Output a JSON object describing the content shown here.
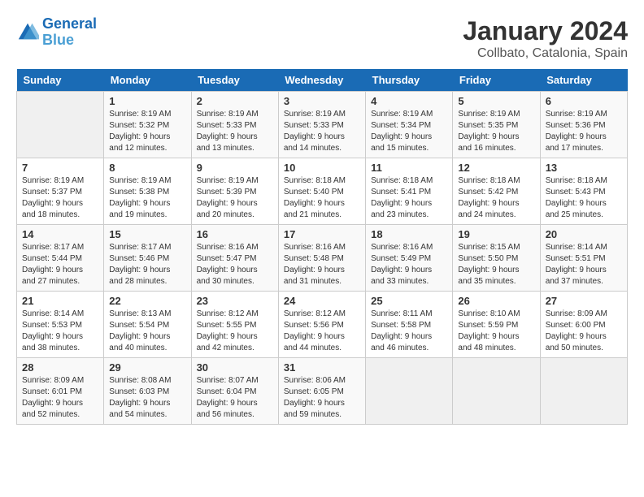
{
  "header": {
    "logo_line1": "General",
    "logo_line2": "Blue",
    "title": "January 2024",
    "subtitle": "Collbato, Catalonia, Spain"
  },
  "days_of_week": [
    "Sunday",
    "Monday",
    "Tuesday",
    "Wednesday",
    "Thursday",
    "Friday",
    "Saturday"
  ],
  "weeks": [
    [
      {
        "day": "",
        "empty": true
      },
      {
        "day": "1",
        "sunrise": "8:19 AM",
        "sunset": "5:32 PM",
        "daylight": "9 hours and 12 minutes."
      },
      {
        "day": "2",
        "sunrise": "8:19 AM",
        "sunset": "5:33 PM",
        "daylight": "9 hours and 13 minutes."
      },
      {
        "day": "3",
        "sunrise": "8:19 AM",
        "sunset": "5:33 PM",
        "daylight": "9 hours and 14 minutes."
      },
      {
        "day": "4",
        "sunrise": "8:19 AM",
        "sunset": "5:34 PM",
        "daylight": "9 hours and 15 minutes."
      },
      {
        "day": "5",
        "sunrise": "8:19 AM",
        "sunset": "5:35 PM",
        "daylight": "9 hours and 16 minutes."
      },
      {
        "day": "6",
        "sunrise": "8:19 AM",
        "sunset": "5:36 PM",
        "daylight": "9 hours and 17 minutes."
      }
    ],
    [
      {
        "day": "7",
        "sunrise": "8:19 AM",
        "sunset": "5:37 PM",
        "daylight": "9 hours and 18 minutes."
      },
      {
        "day": "8",
        "sunrise": "8:19 AM",
        "sunset": "5:38 PM",
        "daylight": "9 hours and 19 minutes."
      },
      {
        "day": "9",
        "sunrise": "8:19 AM",
        "sunset": "5:39 PM",
        "daylight": "9 hours and 20 minutes."
      },
      {
        "day": "10",
        "sunrise": "8:18 AM",
        "sunset": "5:40 PM",
        "daylight": "9 hours and 21 minutes."
      },
      {
        "day": "11",
        "sunrise": "8:18 AM",
        "sunset": "5:41 PM",
        "daylight": "9 hours and 23 minutes."
      },
      {
        "day": "12",
        "sunrise": "8:18 AM",
        "sunset": "5:42 PM",
        "daylight": "9 hours and 24 minutes."
      },
      {
        "day": "13",
        "sunrise": "8:18 AM",
        "sunset": "5:43 PM",
        "daylight": "9 hours and 25 minutes."
      }
    ],
    [
      {
        "day": "14",
        "sunrise": "8:17 AM",
        "sunset": "5:44 PM",
        "daylight": "9 hours and 27 minutes."
      },
      {
        "day": "15",
        "sunrise": "8:17 AM",
        "sunset": "5:46 PM",
        "daylight": "9 hours and 28 minutes."
      },
      {
        "day": "16",
        "sunrise": "8:16 AM",
        "sunset": "5:47 PM",
        "daylight": "9 hours and 30 minutes."
      },
      {
        "day": "17",
        "sunrise": "8:16 AM",
        "sunset": "5:48 PM",
        "daylight": "9 hours and 31 minutes."
      },
      {
        "day": "18",
        "sunrise": "8:16 AM",
        "sunset": "5:49 PM",
        "daylight": "9 hours and 33 minutes."
      },
      {
        "day": "19",
        "sunrise": "8:15 AM",
        "sunset": "5:50 PM",
        "daylight": "9 hours and 35 minutes."
      },
      {
        "day": "20",
        "sunrise": "8:14 AM",
        "sunset": "5:51 PM",
        "daylight": "9 hours and 37 minutes."
      }
    ],
    [
      {
        "day": "21",
        "sunrise": "8:14 AM",
        "sunset": "5:53 PM",
        "daylight": "9 hours and 38 minutes."
      },
      {
        "day": "22",
        "sunrise": "8:13 AM",
        "sunset": "5:54 PM",
        "daylight": "9 hours and 40 minutes."
      },
      {
        "day": "23",
        "sunrise": "8:12 AM",
        "sunset": "5:55 PM",
        "daylight": "9 hours and 42 minutes."
      },
      {
        "day": "24",
        "sunrise": "8:12 AM",
        "sunset": "5:56 PM",
        "daylight": "9 hours and 44 minutes."
      },
      {
        "day": "25",
        "sunrise": "8:11 AM",
        "sunset": "5:58 PM",
        "daylight": "9 hours and 46 minutes."
      },
      {
        "day": "26",
        "sunrise": "8:10 AM",
        "sunset": "5:59 PM",
        "daylight": "9 hours and 48 minutes."
      },
      {
        "day": "27",
        "sunrise": "8:09 AM",
        "sunset": "6:00 PM",
        "daylight": "9 hours and 50 minutes."
      }
    ],
    [
      {
        "day": "28",
        "sunrise": "8:09 AM",
        "sunset": "6:01 PM",
        "daylight": "9 hours and 52 minutes."
      },
      {
        "day": "29",
        "sunrise": "8:08 AM",
        "sunset": "6:03 PM",
        "daylight": "9 hours and 54 minutes."
      },
      {
        "day": "30",
        "sunrise": "8:07 AM",
        "sunset": "6:04 PM",
        "daylight": "9 hours and 56 minutes."
      },
      {
        "day": "31",
        "sunrise": "8:06 AM",
        "sunset": "6:05 PM",
        "daylight": "9 hours and 59 minutes."
      },
      {
        "day": "",
        "empty": true
      },
      {
        "day": "",
        "empty": true
      },
      {
        "day": "",
        "empty": true
      }
    ]
  ]
}
